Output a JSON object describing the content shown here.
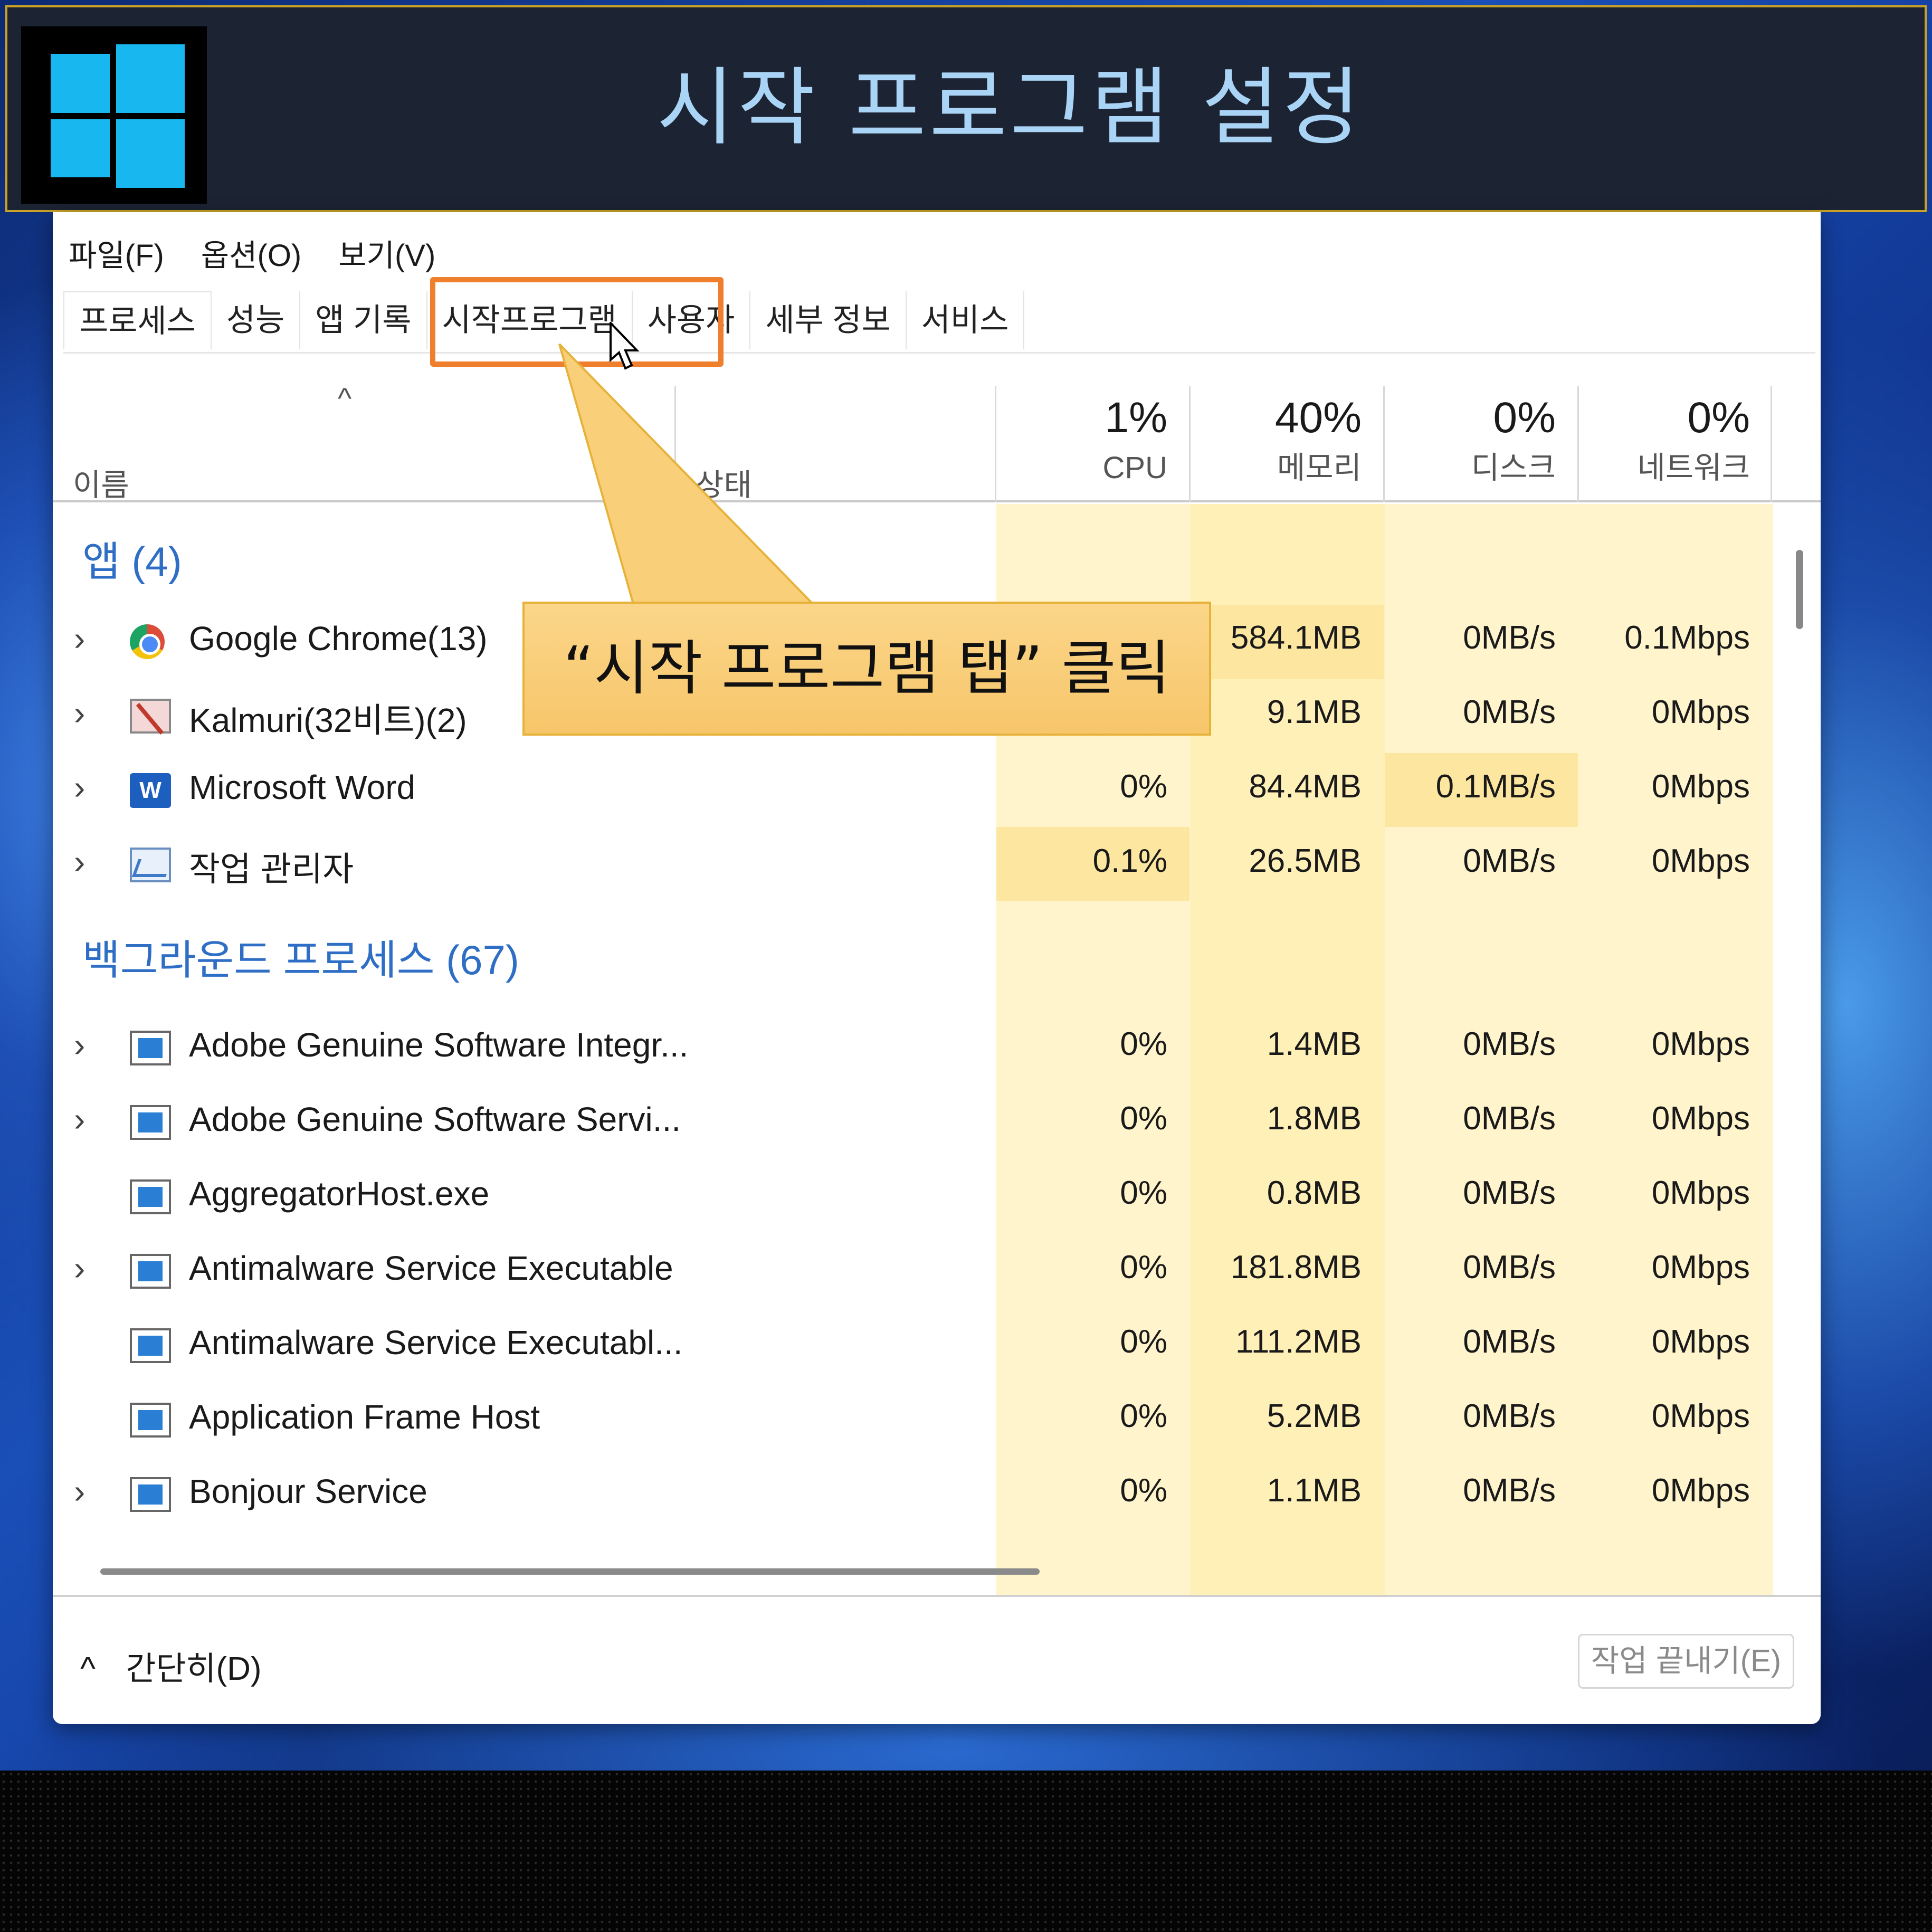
{
  "banner": {
    "title": "시작 프로그램 설정"
  },
  "colors": {
    "accent_orange": "#ef7e2d",
    "group_blue": "#2e6ec5",
    "heat": "#fff4cc",
    "callout": "#f7c66a"
  },
  "menu": [
    "파일(F)",
    "옵션(O)",
    "보기(V)"
  ],
  "tabs": [
    "프로세스",
    "성능",
    "앱 기록",
    "시작프로그램",
    "사용자",
    "세부 정보",
    "서비스"
  ],
  "columns": {
    "name": "이름",
    "status": "상태",
    "cpu": {
      "pct": "1%",
      "label": "CPU"
    },
    "memory": {
      "pct": "40%",
      "label": "메모리"
    },
    "disk": {
      "pct": "0%",
      "label": "디스크"
    },
    "network": {
      "pct": "0%",
      "label": "네트워크"
    }
  },
  "groups": {
    "apps": "앱 (4)",
    "background": "백그라운드 프로세스 (67)"
  },
  "apps": [
    {
      "name": "Google Chrome(13)",
      "icon": "chrome-icon",
      "cpu": "",
      "mem": "584.1MB",
      "disk": "0MB/s",
      "net": "0.1Mbps"
    },
    {
      "name": "Kalmuri(32비트)(2)",
      "icon": "kalmuri-icon",
      "cpu": "",
      "mem": "9.1MB",
      "disk": "0MB/s",
      "net": "0Mbps"
    },
    {
      "name": "Microsoft Word",
      "icon": "word-icon",
      "cpu": "0%",
      "mem": "84.4MB",
      "disk": "0.1MB/s",
      "net": "0Mbps"
    },
    {
      "name": "작업 관리자",
      "icon": "task-manager-icon",
      "cpu": "0.1%",
      "mem": "26.5MB",
      "disk": "0MB/s",
      "net": "0Mbps"
    }
  ],
  "background": [
    {
      "name": "Adobe Genuine Software Integr...",
      "cpu": "0%",
      "mem": "1.4MB",
      "disk": "0MB/s",
      "net": "0Mbps"
    },
    {
      "name": "Adobe Genuine Software Servi...",
      "cpu": "0%",
      "mem": "1.8MB",
      "disk": "0MB/s",
      "net": "0Mbps"
    },
    {
      "name": "AggregatorHost.exe",
      "cpu": "0%",
      "mem": "0.8MB",
      "disk": "0MB/s",
      "net": "0Mbps"
    },
    {
      "name": "Antimalware Service Executable",
      "cpu": "0%",
      "mem": "181.8MB",
      "disk": "0MB/s",
      "net": "0Mbps"
    },
    {
      "name": "Antimalware Service Executabl...",
      "cpu": "0%",
      "mem": "111.2MB",
      "disk": "0MB/s",
      "net": "0Mbps"
    },
    {
      "name": "Application Frame Host",
      "cpu": "0%",
      "mem": "5.2MB",
      "disk": "0MB/s",
      "net": "0Mbps"
    },
    {
      "name": "Bonjour Service",
      "cpu": "0%",
      "mem": "1.1MB",
      "disk": "0MB/s",
      "net": "0Mbps"
    }
  ],
  "footer": {
    "less": "간단히(D)",
    "end_task": "작업 끝내기(E)"
  },
  "callout": {
    "text": "“시작 프로그램 탭” 클릭"
  },
  "icons": {
    "expand": "›",
    "sort": "^",
    "collapse": "^"
  }
}
